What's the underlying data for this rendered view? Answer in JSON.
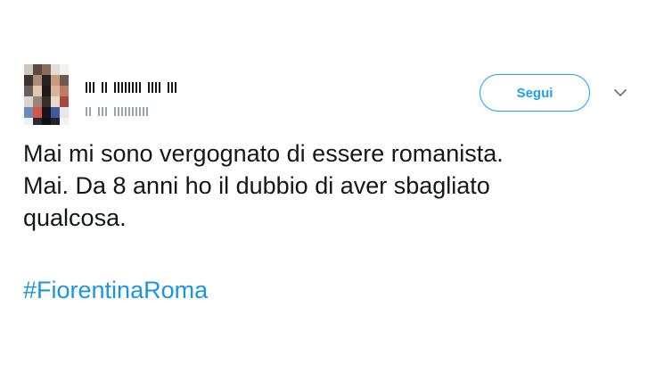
{
  "tweet": {
    "follow_label": "Segui",
    "text_lines": [
      "Mai mi sono vergognato di essere romanista.",
      "Mai. Da 8 anni ho il dubbio di aver sbagliato",
      "qualcosa."
    ],
    "hashtag": "#FiorentinaRoma"
  },
  "colors": {
    "accent": "#1da1f2",
    "hashtag": "#1b95e0",
    "text": "#14171a"
  },
  "icons": {
    "menu": "chevron-down-icon"
  }
}
